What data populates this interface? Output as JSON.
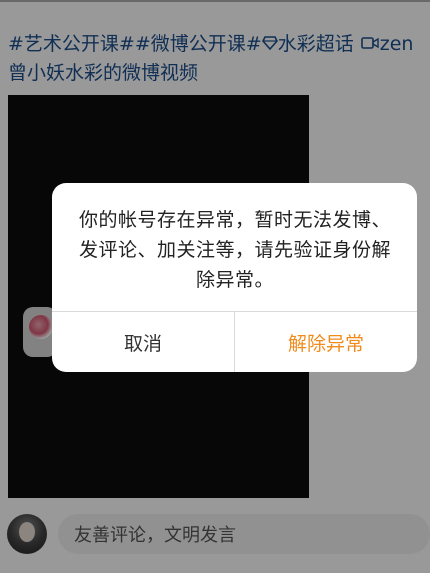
{
  "post": {
    "tags": [
      "#艺术公开课#",
      "#微博公开课#"
    ],
    "supertopic": "水彩超话",
    "video_label": "zen",
    "line2": "曾小妖水彩的微博视频"
  },
  "comment": {
    "placeholder": "友善评论，文明发言"
  },
  "dialog": {
    "message": "你的帐号存在异常，暂时无法发博、发评论、加关注等，请先验证身份解除异常。",
    "cancel_label": "取消",
    "confirm_label": "解除异常"
  },
  "colors": {
    "link": "#1d4f8c",
    "accent": "#f08c1e"
  },
  "icons": {
    "diamond": "diamond-icon",
    "video": "video-icon"
  }
}
